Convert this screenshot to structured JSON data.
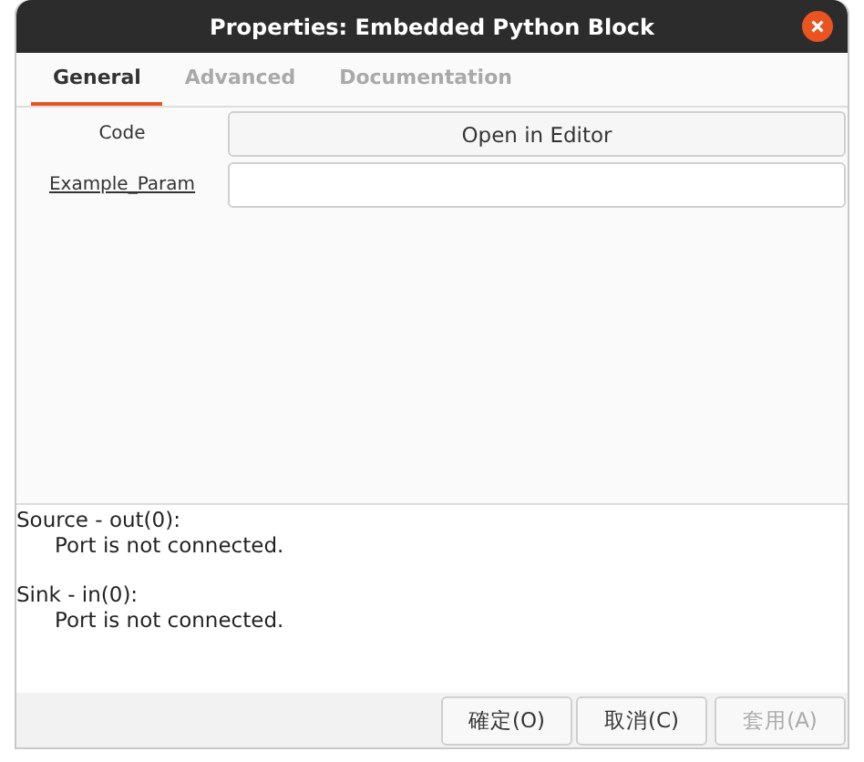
{
  "window": {
    "title": "Properties: Embedded Python Block"
  },
  "tabs": [
    {
      "label": "General",
      "selected": true
    },
    {
      "label": "Advanced",
      "selected": false
    },
    {
      "label": "Documentation",
      "selected": false
    }
  ],
  "params": [
    {
      "label": "Code",
      "underlined": false,
      "kind": "button",
      "text": "Open in Editor"
    },
    {
      "label": "Example_Param",
      "underlined": true,
      "kind": "entry"
    }
  ],
  "ports": [
    {
      "header": "Source - out(0):",
      "message": "Port is not connected."
    },
    {
      "header": "Sink - in(0):",
      "message": "Port is not connected."
    }
  ],
  "buttons": [
    {
      "label": "確定(O)",
      "disabled": false
    },
    {
      "label": "取消(C)",
      "disabled": false
    },
    {
      "label": "套用(A)",
      "disabled": true
    }
  ]
}
